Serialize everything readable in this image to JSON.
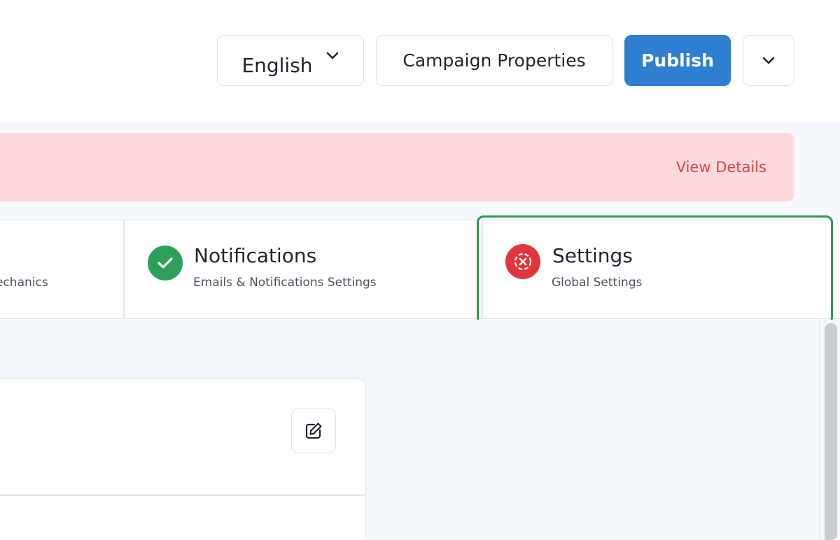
{
  "header": {
    "language": "English",
    "campaign_properties": "Campaign Properties",
    "publish": "Publish"
  },
  "alert": {
    "link": "View Details"
  },
  "tabs": [
    {
      "title": "",
      "subtitle": "echanics"
    },
    {
      "title": "Notifications",
      "subtitle": "Emails & Notifications Settings",
      "status": "complete"
    },
    {
      "title": "Settings",
      "subtitle": "Global Settings",
      "status": "error",
      "selected": true
    }
  ],
  "colors": {
    "primary": "#2f7fd0",
    "alert_bg": "#fdd9db",
    "alert_text": "#d64545",
    "success": "#2e9e5b",
    "error": "#e0353a",
    "highlight": "#2f9a4f"
  },
  "icons": {
    "language_dropdown": "chevron-down-icon",
    "more_menu": "chevron-down-icon",
    "notifications_status": "check-icon",
    "settings_status": "error-circle-icon",
    "edit": "edit-icon"
  }
}
